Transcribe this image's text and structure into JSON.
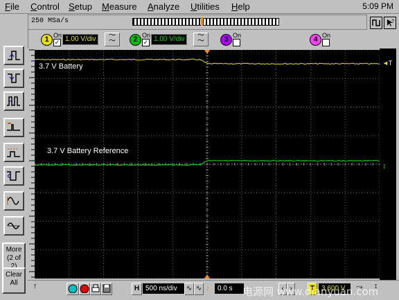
{
  "menu": [
    "File",
    "Control",
    "Setup",
    "Measure",
    "Analyze",
    "Utilities",
    "Help"
  ],
  "clock": "5:09 PM",
  "status": {
    "sample_rate": "250 MSa/s"
  },
  "channels": [
    {
      "num": "1",
      "on_label": "On",
      "checked": true,
      "scale": "1.00 V/div",
      "color": "#e8e000"
    },
    {
      "num": "2",
      "on_label": "On",
      "checked": true,
      "scale": "1.00 V/div",
      "color": "#00e000"
    },
    {
      "num": "3",
      "on_label": "On",
      "checked": false,
      "color": "#b000ff"
    },
    {
      "num": "4",
      "on_label": "On",
      "checked": false,
      "color": "#ff40ff"
    }
  ],
  "traces": {
    "ch1_label": "3.7 V Battery",
    "ch2_label": "3.7 V Battery Reference",
    "trigger_marker": "T"
  },
  "left_toolbar": {
    "more_label": "More",
    "more_sub": "(2 of 2)",
    "clear_label": "Clear",
    "clear_sub": "All"
  },
  "bottom": {
    "h_label": "H",
    "timebase": "500 ns/div",
    "delay": "0.0 s",
    "t_label": "T",
    "trigger_level": "3.600 V"
  },
  "watermark": "电源网 www.dianyuan.com",
  "colors": {
    "ch1": "#e8e000",
    "ch2": "#00e000",
    "grid": "#606060",
    "trigger": "#ff8c00"
  }
}
